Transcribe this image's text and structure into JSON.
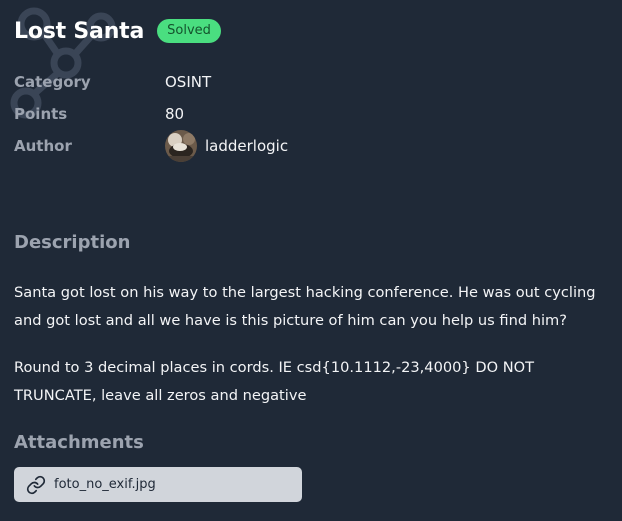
{
  "challenge": {
    "title": "Lost Santa",
    "status": "Solved"
  },
  "meta": {
    "category_label": "Category",
    "category_value": "OSINT",
    "points_label": "Points",
    "points_value": "80",
    "author_label": "Author",
    "author_value": "ladderlogic"
  },
  "description": {
    "heading": "Description",
    "paragraph1": "Santa got lost on his way to the largest hacking conference. He was out cycling and got lost and all we have is this picture of him can you help us find him?",
    "paragraph2": "Round to 3 decimal places in cords. IE csd{10.1112,-23,4000} DO NOT TRUNCATE, leave all zeros and negative"
  },
  "attachments": {
    "heading": "Attachments",
    "files": [
      {
        "name": "foto_no_exif.jpg",
        "icon": "link-icon"
      }
    ]
  },
  "colors": {
    "background": "#1f2937",
    "badge": "#4ade80",
    "muted": "#9ca3af",
    "attachment_bg": "#d1d5db"
  }
}
